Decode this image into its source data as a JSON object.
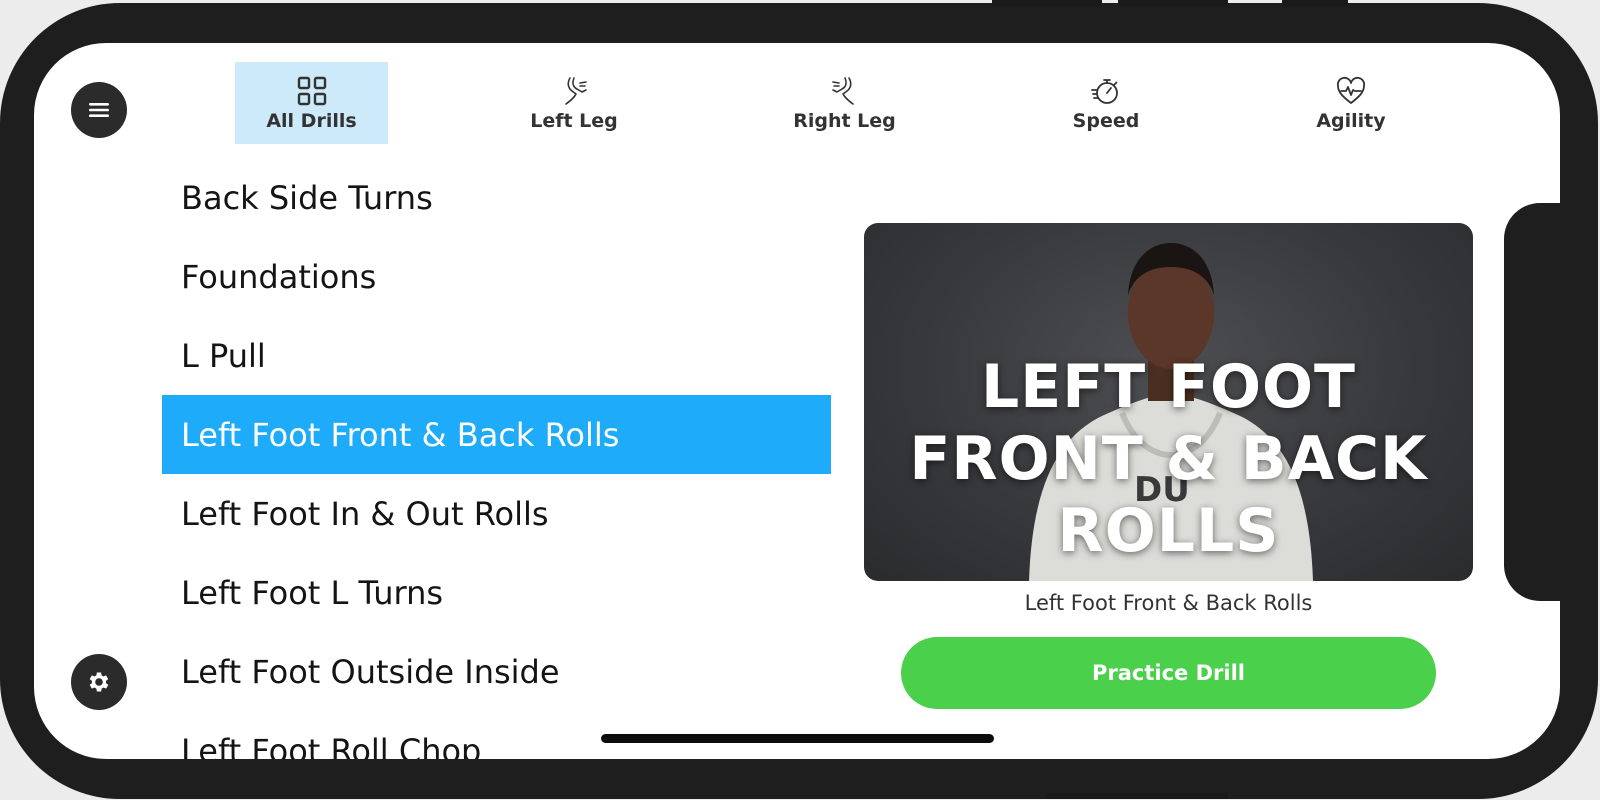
{
  "tabs": [
    {
      "label": "All Drills",
      "icon": "grid-icon",
      "active": true
    },
    {
      "label": "Left Leg",
      "icon": "left-leg-icon",
      "active": false
    },
    {
      "label": "Right Leg",
      "icon": "right-leg-icon",
      "active": false
    },
    {
      "label": "Speed",
      "icon": "stopwatch-icon",
      "active": false
    },
    {
      "label": "Agility",
      "icon": "heartbeat-icon",
      "active": false
    }
  ],
  "drills": [
    "Back Side Turns",
    "Foundations",
    "L Pull",
    "Left Foot Front & Back Rolls",
    "Left Foot In & Out Rolls",
    "Left Foot L Turns",
    "Left Foot Outside Inside",
    "Left Foot Roll Chop"
  ],
  "selected_drill": "Left Foot Front & Back Rolls",
  "preview": {
    "title_overlay": "LEFT FOOT FRONT & BACK ROLLS",
    "shirt_text": "DU",
    "caption": "Left Foot Front & Back Rolls"
  },
  "actions": {
    "practice_label": "Practice Drill",
    "menu_icon": "hamburger-icon",
    "settings_icon": "gear-icon"
  },
  "colors": {
    "accent_blue": "#1eabf9",
    "tab_active_bg": "#cdeafb",
    "practice_green": "#4bd04b",
    "button_dark": "#2b2b2b"
  }
}
